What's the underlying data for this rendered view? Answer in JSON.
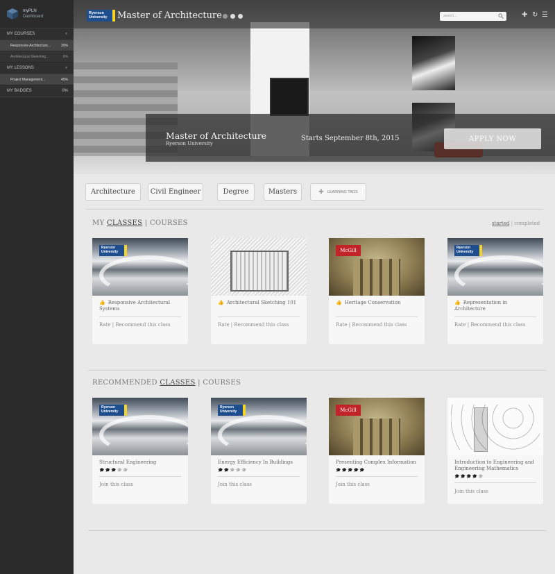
{
  "sidebar": {
    "brand": {
      "name": "myPLN",
      "sub": "Dashboard"
    },
    "sections": [
      {
        "label": "MY COURSES",
        "items": [
          {
            "label": "Responsive Architecture...",
            "value": "30%"
          },
          {
            "label": "Architectural Sketching...",
            "value": "0%"
          }
        ]
      },
      {
        "label": "MY LESSONS",
        "items": [
          {
            "label": "Project Management...",
            "value": "45%"
          }
        ]
      },
      {
        "label": "MY BADGES",
        "value": "0%"
      }
    ]
  },
  "hero": {
    "logo": "Ryerson University",
    "title": "Master of Architecture",
    "search_placeholder": "search...",
    "band_title": "Master of Architecture",
    "band_sub": "Ryerson University",
    "start_text": "Starts September 8th, 2015",
    "apply_label": "APPLY NOW"
  },
  "tags": [
    "Architecture",
    "Civil Engineer",
    "Degree",
    "Masters"
  ],
  "learning_tags_label": "LEARNING TAGS",
  "my_classes": {
    "prefix": "MY",
    "classes": "CLASSES",
    "sep": "|",
    "courses": "COURSES",
    "filter_started": "started",
    "filter_sep": "|",
    "filter_completed": "completed",
    "rate": "Rate",
    "recommend": "Recommend this class",
    "cards": [
      {
        "title": "Responsive Architectural Systems",
        "badge": "Ryerson University",
        "image": "architecture"
      },
      {
        "title": "Architectural Sketching 101",
        "badge": "",
        "image": "sketch"
      },
      {
        "title": "Heritage Conservation",
        "badge": "McGill",
        "image": "stone"
      },
      {
        "title": "Representation in Architecture",
        "badge": "Ryerson University",
        "image": "architecture"
      }
    ]
  },
  "recommended": {
    "prefix": "RECOMMENDED",
    "classes": "CLASSES",
    "sep": "|",
    "courses": "COURSES",
    "join": "Join this class",
    "cards": [
      {
        "title": "Structural Engineering",
        "badge": "Ryerson University",
        "rating": 3,
        "image": "architecture"
      },
      {
        "title": "Energy Efficiency In Buildings",
        "badge": "Ryerson University",
        "rating": 2,
        "image": "architecture"
      },
      {
        "title": "Presenting Complex Information",
        "badge": "McGill",
        "rating": 5,
        "image": "stone"
      },
      {
        "title": "Introduction to Engineering and Engineering Mathematics",
        "badge": "",
        "rating": 4,
        "image": "diagram"
      }
    ]
  },
  "icons": {
    "search": "magnifier",
    "add": "plus",
    "refresh": "refresh",
    "menu": "hamburger",
    "like": "thumbs-up",
    "star": "mortarboard"
  },
  "colors": {
    "sidebar": "#2b2b2b",
    "ryerson_blue": "#1f4e8f",
    "ryerson_yellow": "#f5d328",
    "mcgill_red": "#c22329"
  }
}
